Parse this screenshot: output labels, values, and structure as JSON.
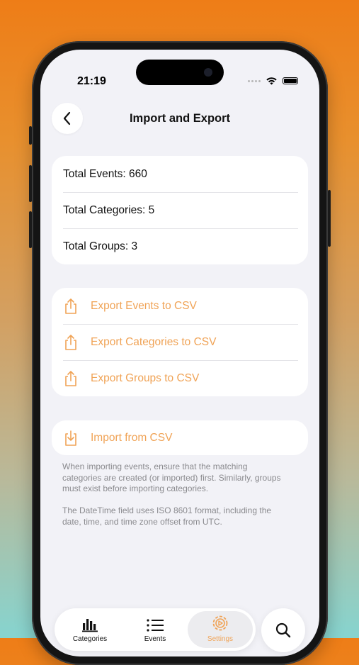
{
  "status_bar": {
    "time": "21:19"
  },
  "nav": {
    "title": "Import and Export"
  },
  "stats": [
    {
      "label": "Total Events: 660"
    },
    {
      "label": "Total Categories: 5"
    },
    {
      "label": "Total Groups: 3"
    }
  ],
  "export_actions": [
    {
      "label": "Export Events to CSV",
      "icon": "share-icon"
    },
    {
      "label": "Export Categories to CSV",
      "icon": "share-icon"
    },
    {
      "label": "Export Groups to CSV",
      "icon": "share-icon"
    }
  ],
  "import_action": {
    "label": "Import from CSV",
    "icon": "download-icon"
  },
  "notes": {
    "import_order": "When importing events, ensure that the matching categories are created (or imported) first. Similarly, groups must exist before importing categories.",
    "datetime": "The DateTime field uses ISO 8601 format, including the date, time, and time zone offset from UTC."
  },
  "tabs": [
    {
      "label": "Categories",
      "icon": "bar-chart-icon",
      "active": false
    },
    {
      "label": "Events",
      "icon": "list-icon",
      "active": false
    },
    {
      "label": "Settings",
      "icon": "settings-icon",
      "active": true
    }
  ],
  "colors": {
    "accent": "#f0a356",
    "background": "#f2f2f7",
    "card": "#ffffff"
  }
}
